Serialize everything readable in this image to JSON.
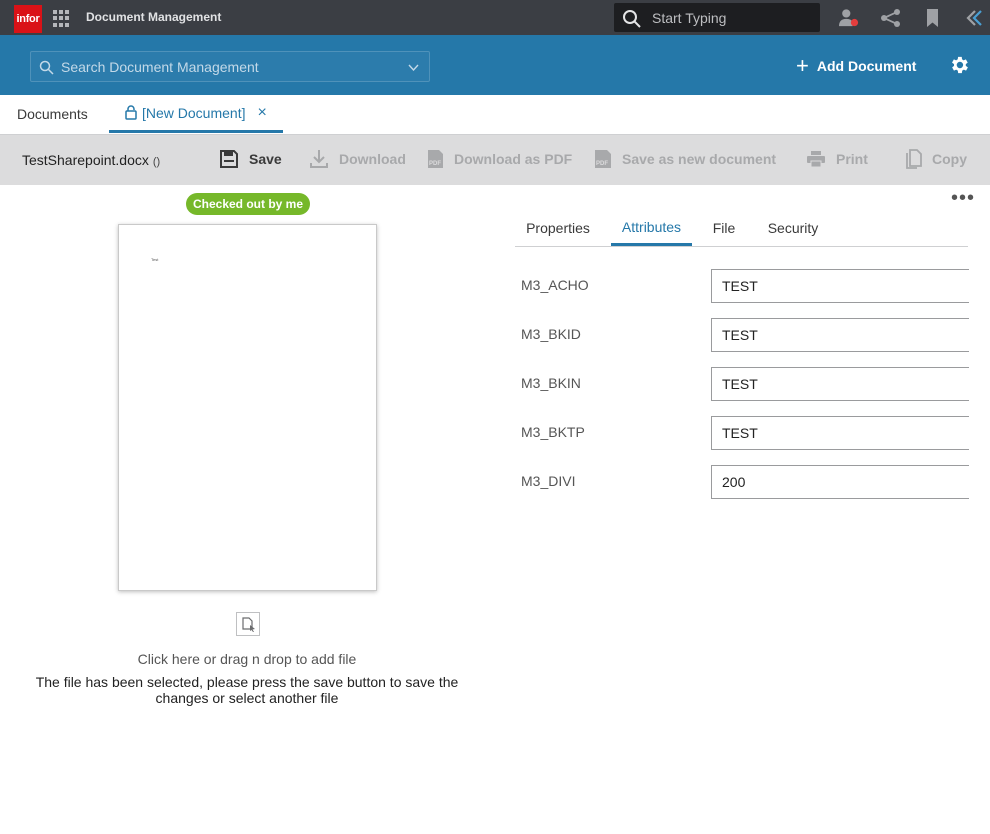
{
  "topbar": {
    "logo_text": "infor",
    "app_title": "Document Management",
    "search_placeholder": "Start Typing",
    "icons": [
      "apps-grid-icon",
      "user-status-icon",
      "share-icon",
      "bookmark-icon",
      "collapse-icon"
    ]
  },
  "header": {
    "search_placeholder": "Search Document Management",
    "add_document_label": "Add Document"
  },
  "tabs": [
    {
      "label": "Documents",
      "active": false
    },
    {
      "label": "[New Document]",
      "active": true,
      "close": "×"
    }
  ],
  "toolbar": {
    "filename": "TestSharepoint.docx",
    "filename_suffix": "()",
    "buttons": [
      {
        "label": "Save",
        "enabled": true
      },
      {
        "label": "Download",
        "enabled": false
      },
      {
        "label": "Download as PDF",
        "enabled": false
      },
      {
        "label": "Save as new document",
        "enabled": false
      },
      {
        "label": "Print",
        "enabled": false
      },
      {
        "label": "Copy",
        "enabled": false
      }
    ]
  },
  "preview": {
    "status_badge": "Checked out by me",
    "page_text": "Test",
    "add_file_text": "Click here or drag n drop to add file",
    "selected_message": "The file has been selected, please press the save button to save the changes or select another file"
  },
  "panel": {
    "more_label": "•••",
    "tabs": [
      {
        "label": "Properties",
        "active": false
      },
      {
        "label": "Attributes",
        "active": true
      },
      {
        "label": "File",
        "active": false
      },
      {
        "label": "Security",
        "active": false
      }
    ],
    "attributes": [
      {
        "label": "M3_ACHO",
        "value": "TEST"
      },
      {
        "label": "M3_BKID",
        "value": "TEST"
      },
      {
        "label": "M3_BKIN",
        "value": "TEST"
      },
      {
        "label": "M3_BKTP",
        "value": "TEST"
      },
      {
        "label": "M3_DIVI",
        "value": "200"
      }
    ]
  },
  "colors": {
    "brand_red": "#da1217",
    "header_blue": "#2578a9",
    "badge_green": "#76b82a",
    "topbar_dark": "#3b3e44"
  }
}
